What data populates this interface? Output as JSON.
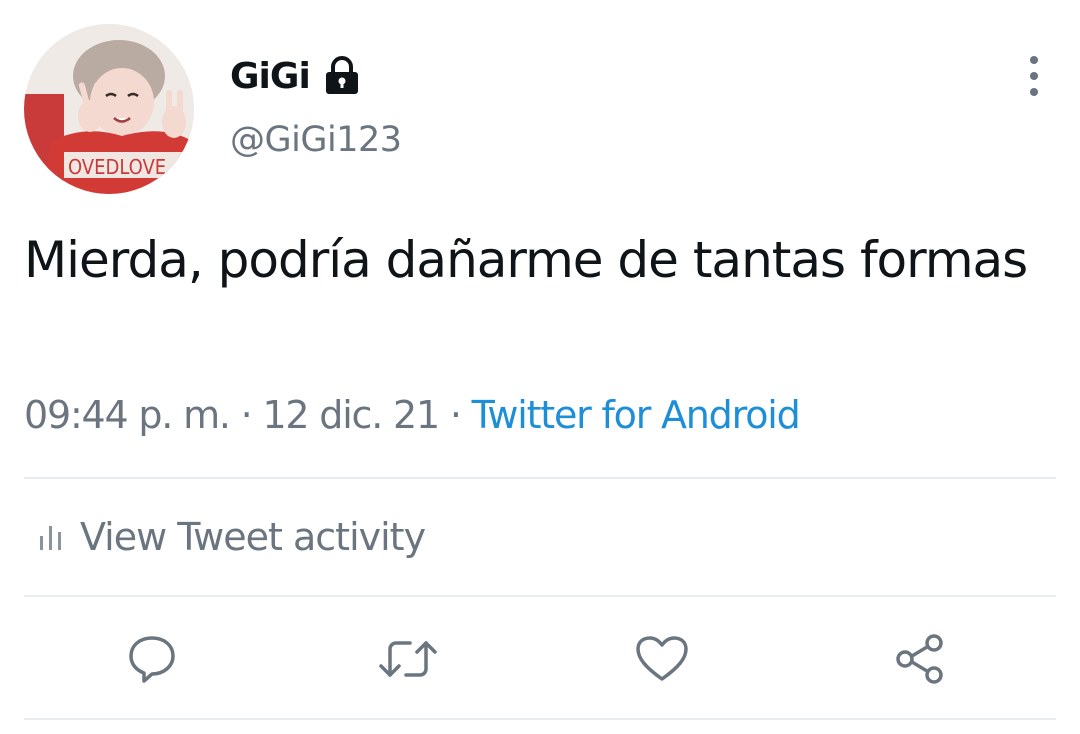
{
  "tweet": {
    "author": {
      "display_name": "GiGi",
      "handle": "@GiGi123",
      "protected": true,
      "avatar_icon": "profile-photo"
    },
    "text": "Mierda, podría dañarme de tantas formas",
    "meta": {
      "time": "09:44 p. m.",
      "separator": "·",
      "date": "12 dic. 21",
      "source": "Twitter for Android"
    },
    "activity_label": "View Tweet activity",
    "actions": [
      {
        "name": "reply",
        "icon": "speech-bubble-icon"
      },
      {
        "name": "retweet",
        "icon": "retweet-arrows-icon"
      },
      {
        "name": "like",
        "icon": "heart-icon"
      },
      {
        "name": "share",
        "icon": "share-nodes-icon"
      }
    ]
  },
  "colors": {
    "text_primary": "#0f1419",
    "text_secondary": "#6b7580",
    "link": "#1d8ed8",
    "divider": "#e8ecef"
  }
}
